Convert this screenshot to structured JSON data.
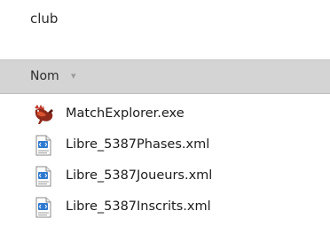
{
  "folder": {
    "name": "club"
  },
  "list_header": {
    "column_label": "Nom",
    "sort_icon": "chevron-down-icon"
  },
  "files": [
    {
      "name": "MatchExplorer.exe",
      "icon": "rooster-app-icon"
    },
    {
      "name": "Libre_5387Phases.xml",
      "icon": "xml-file-icon"
    },
    {
      "name": "Libre_5387Joueurs.xml",
      "icon": "xml-file-icon"
    },
    {
      "name": "Libre_5387Inscrits.xml",
      "icon": "xml-file-icon"
    }
  ],
  "colors": {
    "header_background": "#d4d4d4",
    "app_icon_red": "#b5301e",
    "xml_icon_blue": "#2f7ad0"
  }
}
